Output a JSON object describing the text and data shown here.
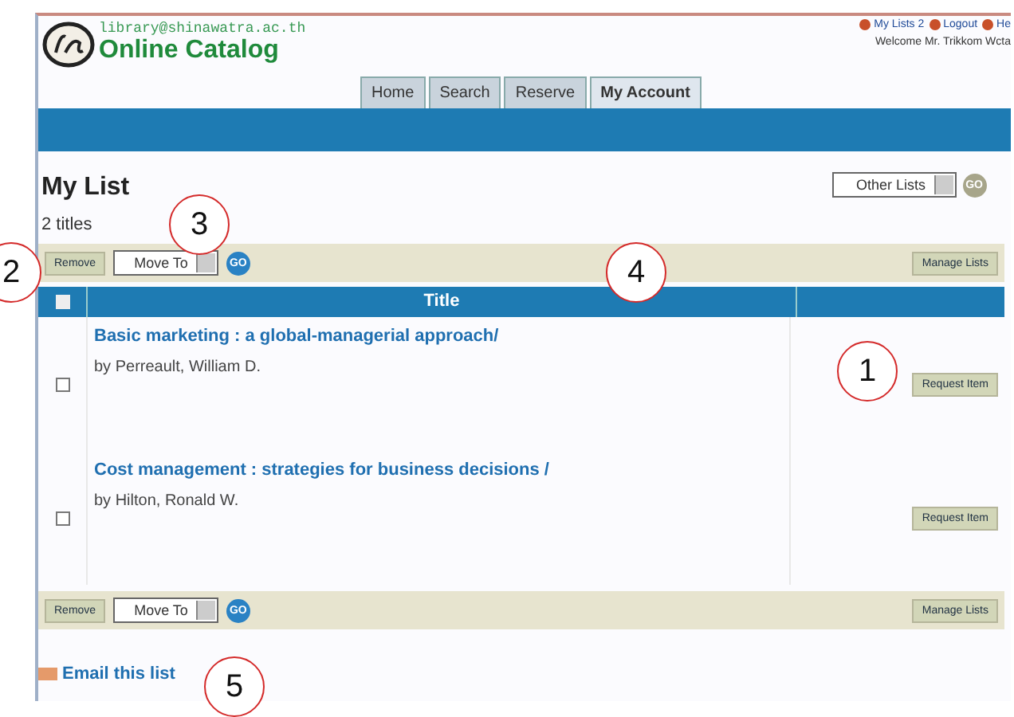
{
  "header": {
    "email": "library@shinawatra.ac.th",
    "site_title": "Online Catalog",
    "top_links": [
      {
        "label": "My Lists 2"
      },
      {
        "label": "Logout"
      },
      {
        "label": "He"
      }
    ],
    "welcome": "Welcome Mr. Trikkom Wcta"
  },
  "tabs": [
    {
      "label": "Home",
      "selected": false
    },
    {
      "label": "Search",
      "selected": false
    },
    {
      "label": "Reserve",
      "selected": false
    },
    {
      "label": "My Account",
      "selected": true
    }
  ],
  "page_title": "My List",
  "other_lists": {
    "value": "Other Lists",
    "go": "GO"
  },
  "count": "2 titles",
  "toolbars": [
    {
      "remove": "Remove",
      "move_to": "Move To",
      "go": "GO",
      "manage": "Manage Lists"
    },
    {
      "remove": "Remove",
      "move_to": "Move To",
      "go": "GO",
      "manage": "Manage Lists"
    }
  ],
  "table": {
    "columns": [
      "Title"
    ],
    "select_all_checked": false,
    "rows": [
      {
        "title": "Basic marketing : a global-managerial approach/",
        "author": "by Perreault, William D.",
        "checked": false,
        "action": "Request Item"
      },
      {
        "title": "Cost management : strategies for business decisions /",
        "author": "by Hilton, Ronald W.",
        "checked": false,
        "action": "Request Item"
      }
    ]
  },
  "email_link": "Email this list",
  "callouts": [
    "1",
    "2",
    "3",
    "4",
    "5"
  ]
}
